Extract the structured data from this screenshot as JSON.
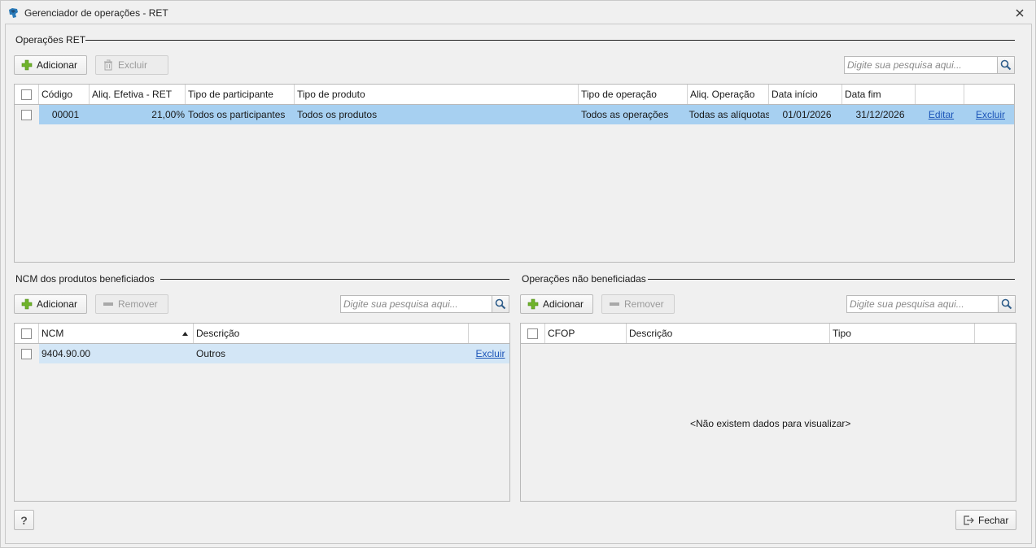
{
  "window": {
    "title": "Gerenciador de operações - RET"
  },
  "operacoes": {
    "section_title": "Operações RET",
    "add_label": "Adicionar",
    "delete_label": "Excluir",
    "search_placeholder": "Digite sua pesquisa aqui...",
    "columns": [
      "Código",
      "Aliq. Efetiva - RET",
      "Tipo de participante",
      "Tipo de produto",
      "Tipo de operação",
      "Aliq. Operação",
      "Data início",
      "Data fim"
    ],
    "rows": [
      {
        "codigo": "00001",
        "aliq_efetiva": "21,00%",
        "tipo_participante": "Todos os participantes",
        "tipo_produto": "Todos os produtos",
        "tipo_operacao": "Todos as operações",
        "aliq_operacao": "Todas as alíquotas",
        "data_inicio": "01/01/2026",
        "data_fim": "31/12/2026",
        "edit_link": "Editar",
        "delete_link": "Excluir"
      }
    ]
  },
  "ncm": {
    "section_title": "NCM dos produtos beneficiados",
    "add_label": "Adicionar",
    "remove_label": "Remover",
    "search_placeholder": "Digite sua pesquisa aqui...",
    "columns": [
      "NCM",
      "Descrição"
    ],
    "rows": [
      {
        "ncm": "9404.90.00",
        "descricao": "Outros",
        "delete_link": "Excluir"
      }
    ]
  },
  "nao_beneficiadas": {
    "section_title": "Operações não beneficiadas",
    "add_label": "Adicionar",
    "remove_label": "Remover",
    "search_placeholder": "Digite sua pesquisa aqui...",
    "columns": [
      "CFOP",
      "Descrição",
      "Tipo"
    ],
    "empty_message": "<Não existem dados para visualizar>"
  },
  "footer": {
    "help_label": "?",
    "close_label": "Fechar"
  },
  "colors": {
    "selected_row": "#a7d0f1",
    "light_selected_row": "#d3e6f6",
    "add_icon": "#6fb32b",
    "link": "#1c55b8"
  }
}
